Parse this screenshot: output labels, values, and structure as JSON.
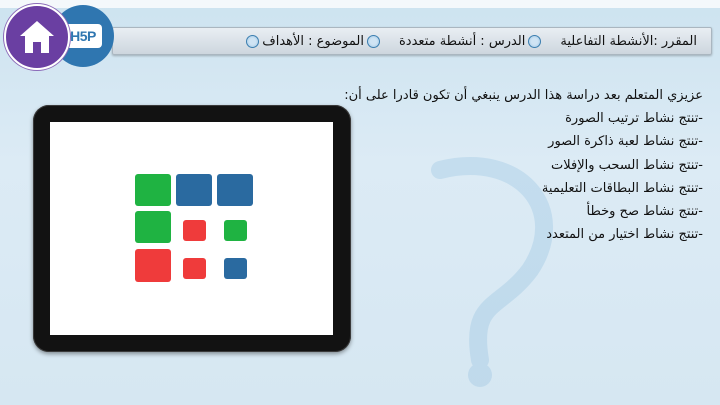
{
  "header": {
    "course_label": "المقرر :الأنشطة التفاعلية",
    "lesson_label": "الدرس : أنشطة متعددة",
    "topic_label": "الموضوع : الأهداف"
  },
  "nav": {
    "home_icon": "home-icon",
    "h5p_logo_text": "H5P"
  },
  "objectives": {
    "intro": "عزيزي المتعلم بعد دراسة هذا الدرس ينبغي أن تكون قادرا على أن:",
    "items": [
      "-تنتج نشاط ترتيب الصورة",
      "-تنتج نشاط لعبة ذاكرة الصور",
      "-تنتج نشاط السحب والإفلات",
      "-تنتج نشاط البطاقات التعليمية",
      "-تنتج نشاط صح وخطأ",
      "-تنتج نشاط اختيار من المتعدد"
    ]
  },
  "tablet_image": {
    "tile_colors": [
      "#1fb342",
      "#2a6aa0",
      "#2a6aa0",
      "#1fb342",
      "#ef3b3b",
      "#1fb342",
      "#ef3b3b",
      "#ef3b3b",
      "#2a6aa0"
    ]
  },
  "colors": {
    "home_bg": "#6a3fa2",
    "h5p_bg": "#2f76b0",
    "green": "#1fb342",
    "blue": "#2a6aa0",
    "red": "#ef3b3b"
  }
}
